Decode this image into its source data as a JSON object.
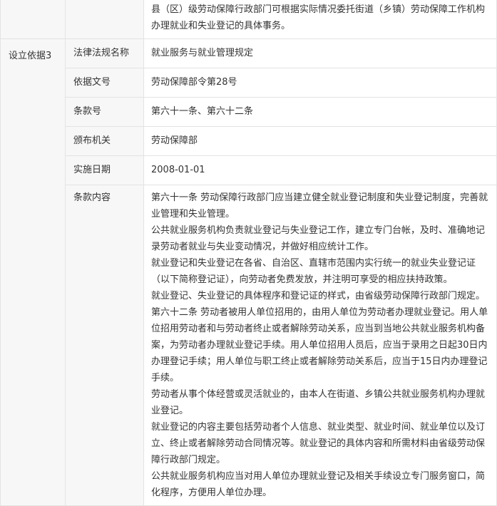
{
  "top_row": {
    "text": "县（区）级劳动保障行政部门可根据实际情况委托街道（乡镇）劳动保障工作机构办理就业和失业登记的具体事务。"
  },
  "basis": {
    "label": "设立依据3",
    "rows": [
      {
        "key": "法律法规名称",
        "value": "就业服务与就业管理规定"
      },
      {
        "key": "依据文号",
        "value": "劳动保障部令第28号"
      },
      {
        "key": "条款号",
        "value": "第六十一条、第六十二条"
      },
      {
        "key": "颁布机关",
        "value": "劳动保障部"
      },
      {
        "key": "实施日期",
        "value": "2008-01-01"
      }
    ],
    "content_key": "条款内容",
    "content_paragraphs": [
      "第六十一条 劳动保障行政部门应当建立健全就业登记制度和失业登记制度，完善就业管理和失业管理。",
      "公共就业服务机构负责就业登记与失业登记工作，建立专门台帐，及时、准确地记录劳动者就业与失业变动情况，并做好相应统计工作。",
      "就业登记和失业登记在各省、自治区、直辖市范围内实行统一的就业失业登记证（以下简称登记证），向劳动者免费发放，并注明可享受的相应扶持政策。",
      "就业登记、失业登记的具体程序和登记证的样式，由省级劳动保障行政部门规定。",
      "第六十二条 劳动者被用人单位招用的，由用人单位为劳动者办理就业登记。用人单位招用劳动者和与劳动者终止或者解除劳动关系，应当到当地公共就业服务机构备案，为劳动者办理就业登记手续。用人单位招用人员后，应当于录用之日起30日内办理登记手续；用人单位与职工终止或者解除劳动关系后，应当于15日内办理登记手续。",
      "劳动者从事个体经营或灵活就业的，由本人在街道、乡镇公共就业服务机构办理就业登记。",
      "就业登记的内容主要包括劳动者个人信息、就业类型、就业时间、就业单位以及订立、终止或者解除劳动合同情况等。就业登记的具体内容和所需材料由省级劳动保障行政部门规定。",
      "公共就业服务机构应当对用人单位办理就业登记及相关手续设立专门服务窗口，简化程序，方便用人单位办理。"
    ]
  }
}
